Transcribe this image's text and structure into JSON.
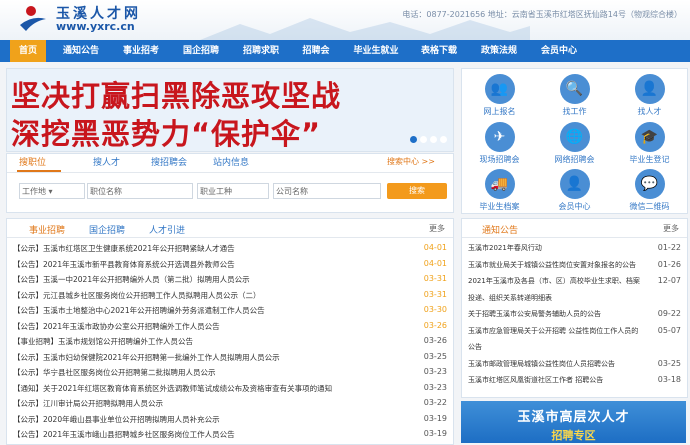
{
  "header": {
    "logo_title": "玉溪人才网",
    "logo_url": "www.yxrc.cn",
    "contact": "电话：0877-2021656  地址：云南省玉溪市红塔区抚仙路14号（物观综合楼）"
  },
  "nav": [
    "首页",
    "通知公告",
    "事业招考",
    "国企招聘",
    "招聘求职",
    "招聘会",
    "毕业生就业",
    "表格下载",
    "政策法规",
    "会员中心"
  ],
  "banner": {
    "line1": "坚决打赢扫黑除恶攻坚战",
    "line2": "深挖黑恶势力“保护伞”"
  },
  "services": [
    {
      "label": "网上报名",
      "icon": "people-icon",
      "color": "#4a8ed4"
    },
    {
      "label": "找工作",
      "icon": "magnifier-icon",
      "color": "#4a8ed4"
    },
    {
      "label": "找人才",
      "icon": "person-icon",
      "color": "#4a8ed4"
    },
    {
      "label": "现场招聘会",
      "icon": "paper-plane-icon",
      "color": "#4a8ed4"
    },
    {
      "label": "网络招聘会",
      "icon": "globe-icon",
      "color": "#4a8ed4"
    },
    {
      "label": "毕业生登记",
      "icon": "graduation-cap-icon",
      "color": "#4a8ed4"
    },
    {
      "label": "毕业生档案",
      "icon": "truck-icon",
      "color": "#4a8ed4"
    },
    {
      "label": "会员中心",
      "icon": "user-icon",
      "color": "#4a8ed4"
    },
    {
      "label": "微信二维码",
      "icon": "wechat-icon",
      "color": "#4a8ed4"
    }
  ],
  "search": {
    "tabs": [
      "搜职位",
      "搜人才",
      "搜招聘会",
      "站内信息"
    ],
    "center": "搜索中心 >>",
    "select": "工作地",
    "f1": "职位名称",
    "f2": "职业工种",
    "f3": "公司名称",
    "button": "搜索"
  },
  "left_panel": {
    "tabs": [
      "事业招聘",
      "国企招聘",
      "人才引进"
    ],
    "more": "更多",
    "rows": [
      {
        "t": "【公示】玉溪市红塔区卫生健康系统2021年公开招聘紧缺人才通告",
        "d": "04-01",
        "hot": true
      },
      {
        "t": "【公告】2021年玉溪市新平县教育体育系统公开选调县外教师公告",
        "d": "04-01",
        "hot": true
      },
      {
        "t": "【公告】玉溪一中2021年公开招聘编外人员（第二批）拟聘用人员公示",
        "d": "03-31",
        "hot": true
      },
      {
        "t": "【公示】元江县城乡社区服务岗位公开招聘工作人员拟聘用人员公示（二）",
        "d": "03-31",
        "hot": true
      },
      {
        "t": "【公告】玉溪市土地整治中心2021年公开招聘编外劳务派遣制工作人员公告",
        "d": "03-30",
        "hot": true
      },
      {
        "t": "【公告】2021年玉溪市政协办公室公开招聘编外工作人员公告",
        "d": "03-26",
        "hot": true
      },
      {
        "t": "【事业招聘】玉溪市规划馆公开招聘编外工作人员公告",
        "d": "03-26",
        "hot": false
      },
      {
        "t": "【公示】玉溪市妇幼保健院2021年公开招聘第一批编外工作人员拟聘用人员公示",
        "d": "03-25",
        "hot": false
      },
      {
        "t": "【公示】华宁县社区服务岗位公开招聘第二批拟聘用人员公示",
        "d": "03-23",
        "hot": false
      },
      {
        "t": "【通知】关于2021年红塔区教育体育系统区外选调教师笔试成绩公布及资格审查有关事项的通知",
        "d": "03-23",
        "hot": false
      },
      {
        "t": "【公示】江川审计局公开招聘拟聘用人员公示",
        "d": "03-22",
        "hot": false
      },
      {
        "t": "【公示】2020年峨山县事业单位公开招聘拟聘用人员补充公示",
        "d": "03-19",
        "hot": false
      },
      {
        "t": "【公告】2021年玉溪市峨山县招聘城乡社区服务岗位工作人员公告",
        "d": "03-19",
        "hot": false
      }
    ]
  },
  "right_panel": {
    "tab": "通知公告",
    "more": "更多",
    "rows": [
      {
        "t": "玉溪市2021年春风行动",
        "d": "01-22"
      },
      {
        "t": "玉溪市就业局关于城镇公益性岗位安置对象报名的公告",
        "d": "01-26"
      },
      {
        "t": "2021年玉溪市及各县（市、区）高校毕业生求职、档案",
        "d": "12-07"
      },
      {
        "t": "投递、组织关系转递明细表",
        "d": ""
      },
      {
        "t": "关于招聘玉溪市公安局警务辅助人员的公告",
        "d": "09-22"
      },
      {
        "t": "玉溪市应急管理局关于公开招聘 公益性岗位工作人员的",
        "d": "05-07"
      },
      {
        "t": "公告",
        "d": ""
      },
      {
        "t": "玉溪市邮政管理局城镇公益性岗位人员招聘公告",
        "d": "03-25"
      },
      {
        "t": "玉溪市红塔区风凰街道社区工作者 招聘公告",
        "d": "03-18"
      }
    ]
  },
  "promo": {
    "t1": "玉溪市高层次人才",
    "t2": "招聘专区"
  }
}
